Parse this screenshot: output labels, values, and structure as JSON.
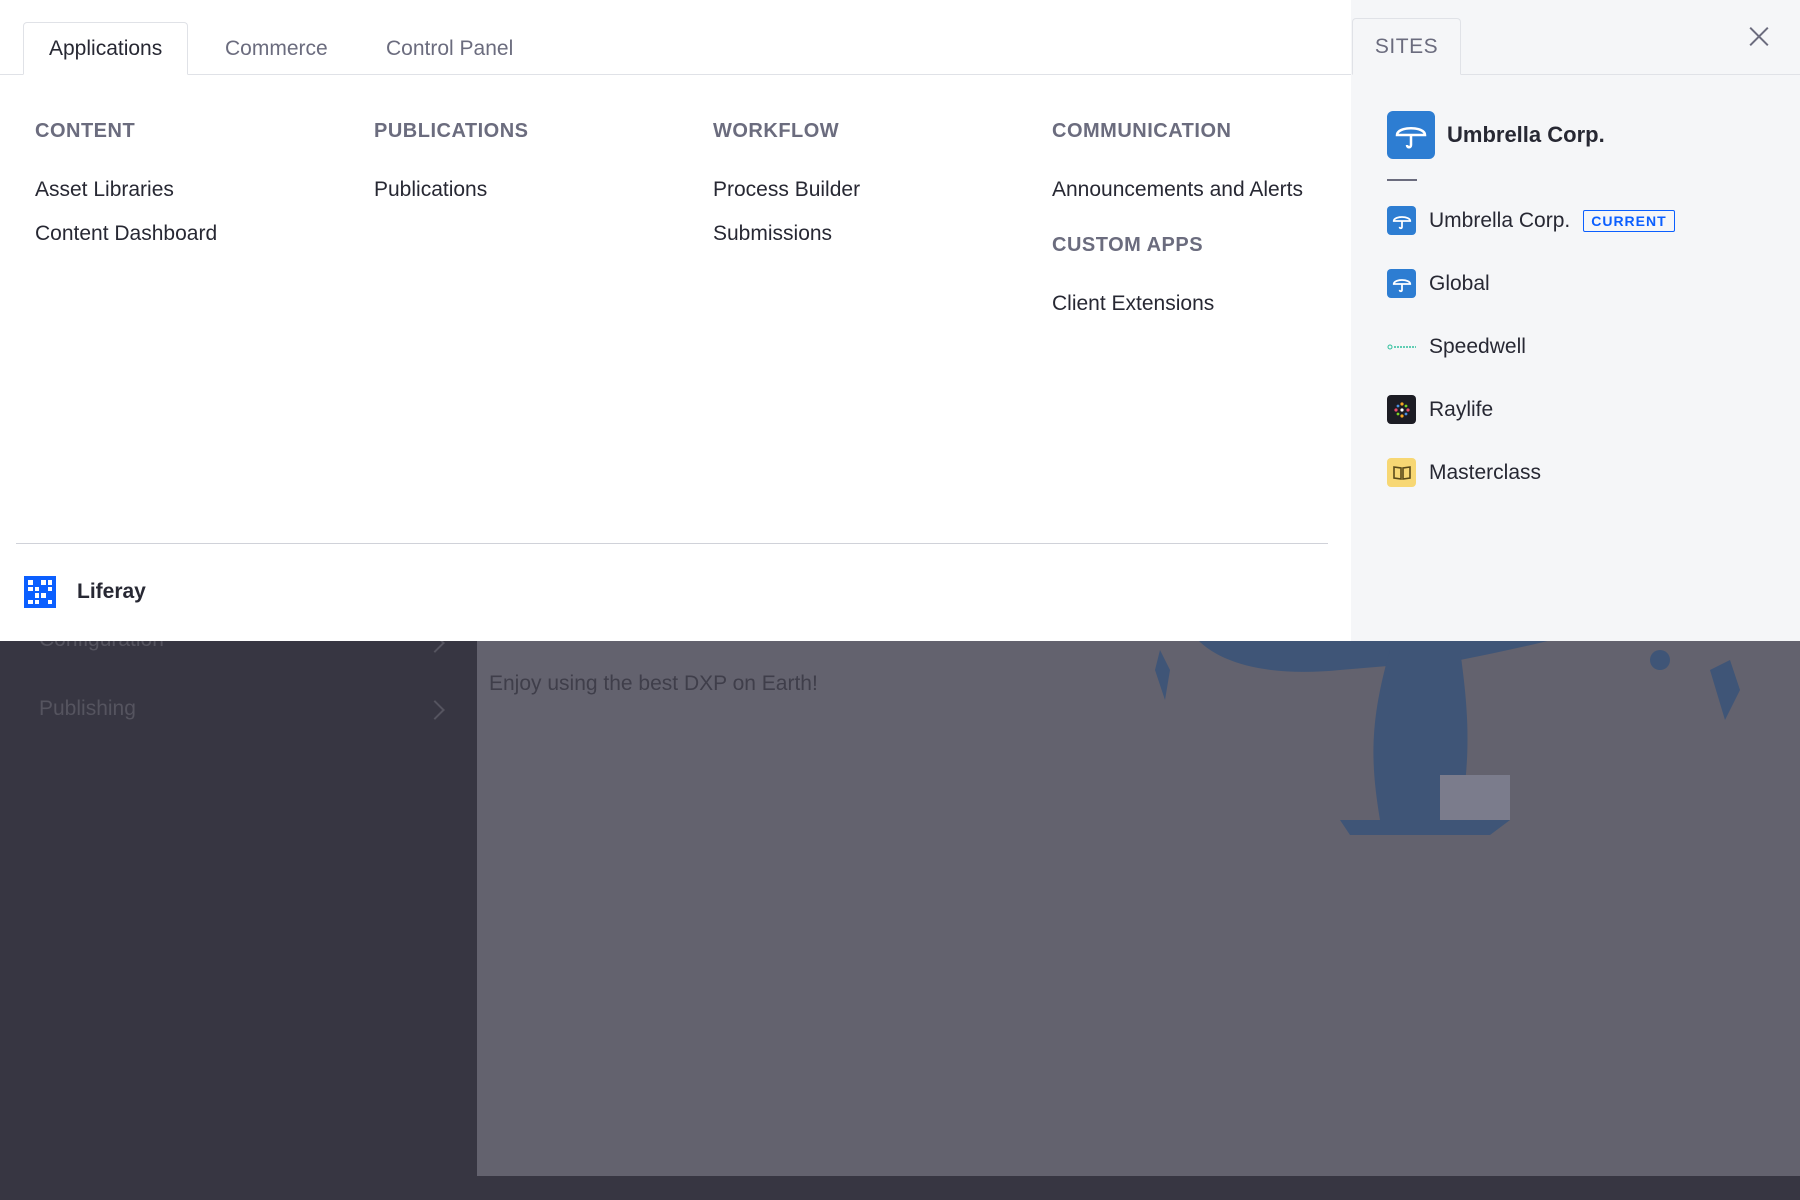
{
  "background": {
    "sidebar": {
      "items": [
        {
          "label": "Configuration"
        },
        {
          "label": "Publishing"
        }
      ]
    },
    "tagline": "Enjoy using the best DXP on Earth!"
  },
  "menu": {
    "tabs": [
      {
        "label": "Applications",
        "active": true
      },
      {
        "label": "Commerce",
        "active": false
      },
      {
        "label": "Control Panel",
        "active": false
      }
    ],
    "columns": {
      "content": {
        "heading": "CONTENT",
        "items": [
          "Asset Libraries",
          "Content Dashboard"
        ]
      },
      "publications": {
        "heading": "PUBLICATIONS",
        "items": [
          "Publications"
        ]
      },
      "workflow": {
        "heading": "WORKFLOW",
        "items": [
          "Process Builder",
          "Submissions"
        ]
      },
      "communication": {
        "heading": "COMMUNICATION",
        "items": [
          "Announcements and Alerts"
        ]
      },
      "custom_apps": {
        "heading": "CUSTOM APPS",
        "items": [
          "Client Extensions"
        ]
      }
    },
    "footer": {
      "label": "Liferay"
    }
  },
  "sites": {
    "tab_label": "SITES",
    "current_site": {
      "label": "Umbrella Corp.",
      "icon": "umbrella-icon"
    },
    "list": [
      {
        "label": "Umbrella Corp.",
        "badge": "CURRENT",
        "icon": "umbrella-icon"
      },
      {
        "label": "Global",
        "icon": "umbrella-icon"
      },
      {
        "label": "Speedwell",
        "icon": "speedwell-logo"
      },
      {
        "label": "Raylife",
        "icon": "raylife-logo"
      },
      {
        "label": "Masterclass",
        "icon": "book-icon"
      }
    ]
  },
  "colors": {
    "accent": "#0b5fff",
    "site_blue": "#2d7dd2",
    "text": "#272833",
    "muted": "#6b6c7e",
    "overlay_bg": "#63626e"
  }
}
